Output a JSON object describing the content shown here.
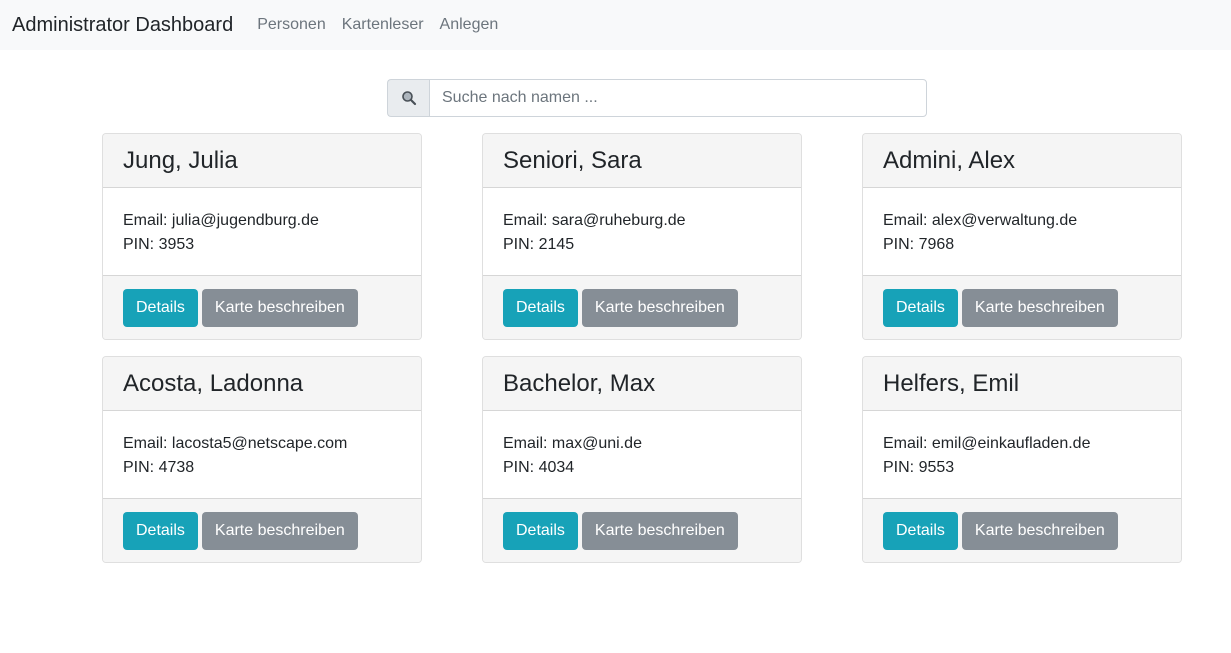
{
  "navbar": {
    "brand": "Administrator Dashboard",
    "links": [
      "Personen",
      "Kartenleser",
      "Anlegen"
    ]
  },
  "search": {
    "placeholder": "Suche nach namen ...",
    "value": "",
    "icon": "search-icon"
  },
  "labels": {
    "email_prefix": "Email: ",
    "pin_prefix": "PIN: ",
    "details_button": "Details",
    "write_card_button": "Karte beschreiben"
  },
  "persons": [
    {
      "name": "Jung, Julia",
      "email": "julia@jugendburg.de",
      "pin": "3953"
    },
    {
      "name": "Seniori, Sara",
      "email": "sara@ruheburg.de",
      "pin": "2145"
    },
    {
      "name": "Admini, Alex",
      "email": "alex@verwaltung.de",
      "pin": "7968"
    },
    {
      "name": "Acosta, Ladonna",
      "email": "lacosta5@netscape.com",
      "pin": "4738"
    },
    {
      "name": "Bachelor, Max",
      "email": "max@uni.de",
      "pin": "4034"
    },
    {
      "name": "Helfers, Emil",
      "email": "emil@einkaufladen.de",
      "pin": "9553"
    }
  ],
  "colors": {
    "navbar_bg": "#f8f9fa",
    "info_button": "#17a2b8",
    "secondary_button": "#868e96"
  }
}
